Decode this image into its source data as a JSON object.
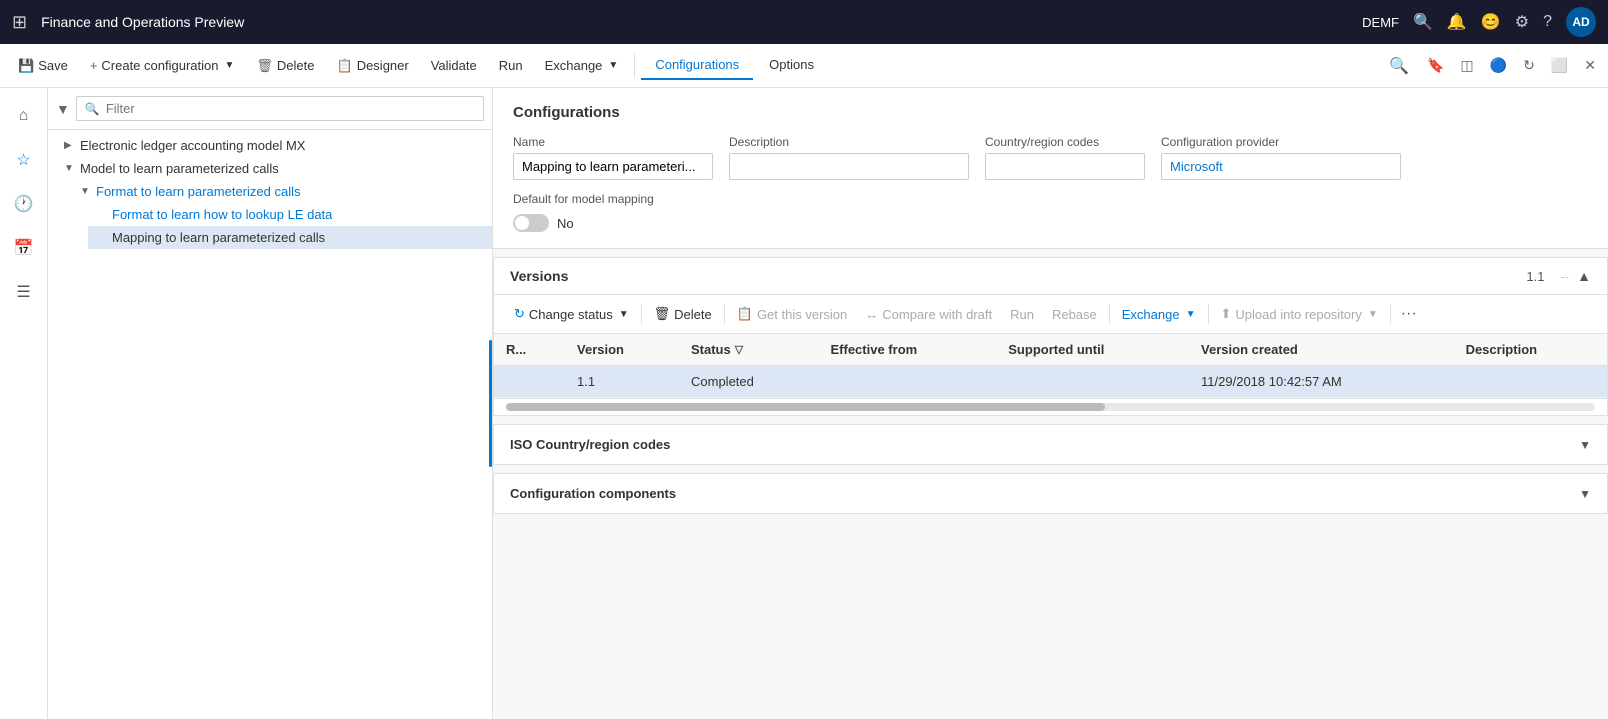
{
  "titleBar": {
    "appTitle": "Finance and Operations Preview",
    "environment": "DEMF",
    "avatar": "AD"
  },
  "commandBar": {
    "saveLabel": "Save",
    "createConfigLabel": "Create configuration",
    "deleteLabel": "Delete",
    "designerLabel": "Designer",
    "validateLabel": "Validate",
    "runLabel": "Run",
    "exchangeLabel": "Exchange",
    "tabs": [
      {
        "label": "Configurations",
        "active": true
      },
      {
        "label": "Options",
        "active": false
      }
    ]
  },
  "sidebar": {
    "filterPlaceholder": "Filter",
    "treeItems": [
      {
        "level": 1,
        "label": "Electronic ledger accounting model MX",
        "toggle": "▶",
        "isLink": false,
        "selected": false
      },
      {
        "level": 1,
        "label": "Model to learn parameterized calls",
        "toggle": "▼",
        "isLink": false,
        "selected": false
      },
      {
        "level": 2,
        "label": "Format to learn parameterized calls",
        "toggle": "▼",
        "isLink": false,
        "selected": false
      },
      {
        "level": 3,
        "label": "Format to learn how to lookup LE data",
        "toggle": "",
        "isLink": true,
        "selected": false
      },
      {
        "level": 3,
        "label": "Mapping to learn parameterized calls",
        "toggle": "",
        "isLink": false,
        "selected": true
      }
    ]
  },
  "configPanel": {
    "title": "Configurations",
    "fields": {
      "nameLabel": "Name",
      "nameValue": "Mapping to learn parameteri...",
      "descriptionLabel": "Description",
      "descriptionValue": "",
      "countryRegionLabel": "Country/region codes",
      "countryRegionValue": "",
      "configProviderLabel": "Configuration provider",
      "configProviderValue": "Microsoft",
      "defaultMappingLabel": "Default for model mapping",
      "defaultMappingToggle": "No"
    }
  },
  "versionsSection": {
    "title": "Versions",
    "badge": "1.1",
    "toolbar": {
      "changeStatusLabel": "Change status",
      "deleteLabel": "Delete",
      "getThisVersionLabel": "Get this version",
      "compareWithDraftLabel": "Compare with draft",
      "runLabel": "Run",
      "rebaseLabel": "Rebase",
      "exchangeLabel": "Exchange",
      "uploadIntoRepositoryLabel": "Upload into repository"
    },
    "tableHeaders": [
      {
        "label": "R..."
      },
      {
        "label": "Version"
      },
      {
        "label": "Status",
        "hasFilter": true
      },
      {
        "label": "Effective from"
      },
      {
        "label": "Supported until"
      },
      {
        "label": "Version created"
      },
      {
        "label": "Description"
      }
    ],
    "rows": [
      {
        "r": "",
        "version": "1.1",
        "status": "Completed",
        "effectiveFrom": "",
        "supportedUntil": "",
        "versionCreated": "11/29/2018 10:42:57 AM",
        "description": "",
        "selected": true
      }
    ]
  },
  "bottomSections": [
    {
      "title": "ISO Country/region codes"
    },
    {
      "title": "Configuration components"
    }
  ]
}
